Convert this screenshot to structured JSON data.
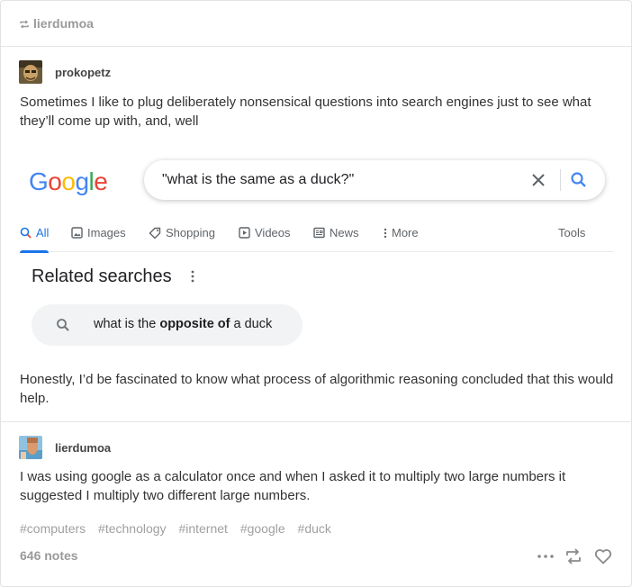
{
  "reblog": {
    "username": "lierdumoa",
    "icon": "reblog-icon"
  },
  "posts": [
    {
      "username": "prokopetz",
      "text1": "Sometimes I like to plug deliberately nonsensical questions into search engines just to see what they’ll come up with, and, well",
      "text2": "Honestly, I’d be fascinated to know what process of algorithmic reasoning concluded that this would help."
    },
    {
      "username": "lierdumoa",
      "text": "I was using google as a calculator once and when I asked it to multiply two large numbers it suggested I multiply two different large numbers."
    }
  ],
  "google": {
    "logo": [
      "G",
      "o",
      "o",
      "g",
      "l",
      "e"
    ],
    "query": "\"what is the same as a duck?\"",
    "tabs": [
      "All",
      "Images",
      "Shopping",
      "Videos",
      "News",
      "More"
    ],
    "tools": "Tools",
    "related_title": "Related searches",
    "related": {
      "before": "what is the ",
      "bold": "opposite of",
      "after": " a duck"
    },
    "colors": {
      "blue": "#4285F4",
      "red": "#EA4335",
      "yellow": "#FBBC05",
      "green": "#34A853",
      "accent": "#1a73e8"
    }
  },
  "tags": [
    "#computers",
    "#technology",
    "#internet",
    "#google",
    "#duck"
  ],
  "notes": "646 notes",
  "actions": [
    "more-icon",
    "reblog-icon",
    "heart-icon"
  ]
}
